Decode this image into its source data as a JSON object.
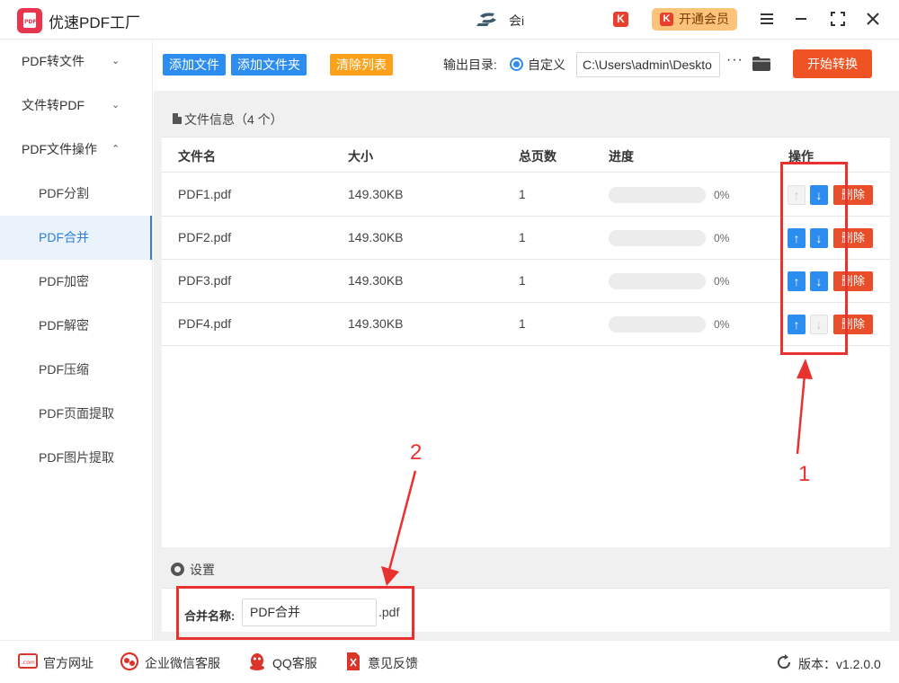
{
  "app": {
    "title": "优速PDF工厂",
    "logo_text": "PDF",
    "ad_text": "会i",
    "vip_label": "开通会员",
    "k_badge": "K"
  },
  "sidebar": {
    "groups": [
      {
        "label": "PDF转文件",
        "chevron": "⌄"
      },
      {
        "label": "文件转PDF",
        "chevron": "⌄"
      },
      {
        "label": "PDF文件操作",
        "chevron": "⌃"
      }
    ],
    "items": [
      "PDF分割",
      "PDF合并",
      "PDF加密",
      "PDF解密",
      "PDF压缩",
      "PDF页面提取",
      "PDF图片提取"
    ],
    "active_item": "PDF合并"
  },
  "toolbar": {
    "add_file": "添加文件",
    "add_folder": "添加文件夹",
    "clear_list": "清除列表",
    "output_label": "输出目录:",
    "radio_label": "自定义",
    "output_path": "C:\\Users\\admin\\Deskto",
    "more": "···",
    "start": "开始转换"
  },
  "file_panel": {
    "title": "文件信息（4 个）",
    "columns": [
      "文件名",
      "大小",
      "总页数",
      "进度",
      "操作"
    ],
    "rows": [
      {
        "name": "PDF1.pdf",
        "size": "149.30KB",
        "pages": "1",
        "progress": 0,
        "progress_text": "0%",
        "up_enabled": false,
        "down_enabled": true
      },
      {
        "name": "PDF2.pdf",
        "size": "149.30KB",
        "pages": "1",
        "progress": 0,
        "progress_text": "0%",
        "up_enabled": true,
        "down_enabled": true
      },
      {
        "name": "PDF3.pdf",
        "size": "149.30KB",
        "pages": "1",
        "progress": 0,
        "progress_text": "0%",
        "up_enabled": true,
        "down_enabled": true
      },
      {
        "name": "PDF4.pdf",
        "size": "149.30KB",
        "pages": "1",
        "progress": 0,
        "progress_text": "0%",
        "up_enabled": true,
        "down_enabled": false
      }
    ],
    "delete_label": "删除",
    "up_arrow": "↑",
    "down_arrow": "↓"
  },
  "settings": {
    "title": "设置",
    "merge_label": "合并名称:",
    "merge_value": "PDF合并",
    "merge_ext": ".pdf"
  },
  "annotations": {
    "label_1": "1",
    "label_2": "2",
    "color": "#e8322f"
  },
  "footer": {
    "links": [
      "官方网址",
      "企业微信客服",
      "QQ客服",
      "意见反馈"
    ],
    "version": "版本：v1.2.0.0"
  },
  "colors": {
    "accent_blue": "#2d8cf0",
    "start_red": "#f05323",
    "clear_orange": "#fca21a",
    "delete_red": "#e84e2a",
    "vip_gold": "#fbc47a"
  }
}
